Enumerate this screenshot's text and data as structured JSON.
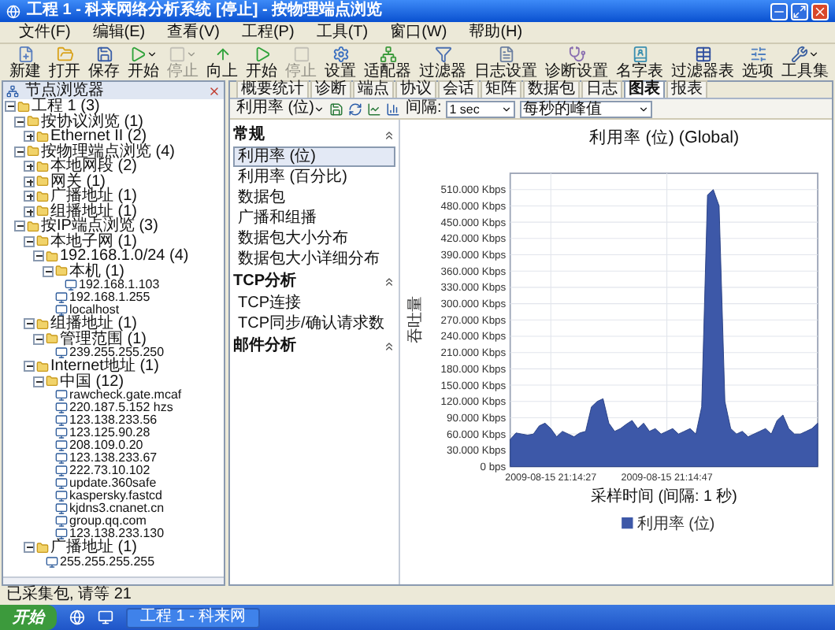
{
  "window": {
    "title": "工程 1 - 科来网络分析系统 [停止] - 按物理端点浏览"
  },
  "menu": [
    "文件(F)",
    "编辑(E)",
    "查看(V)",
    "工程(P)",
    "工具(T)",
    "窗口(W)",
    "帮助(H)"
  ],
  "toolbar": [
    {
      "label": "新建",
      "kind": "button",
      "disabled": false
    },
    {
      "label": "打开",
      "kind": "button",
      "disabled": false
    },
    {
      "label": "保存",
      "kind": "button",
      "disabled": false
    },
    {
      "label": "开始",
      "kind": "dropdown",
      "disabled": false
    },
    {
      "label": "停止",
      "kind": "dropdown",
      "disabled": true
    },
    {
      "label": "向上",
      "kind": "button",
      "disabled": false
    },
    {
      "label": "开始",
      "kind": "button",
      "disabled": false
    },
    {
      "label": "停止",
      "kind": "button",
      "disabled": true
    },
    {
      "label": "设置",
      "kind": "button",
      "disabled": false
    },
    {
      "label": "适配器",
      "kind": "button",
      "disabled": false
    },
    {
      "label": "过滤器",
      "kind": "button",
      "disabled": false
    },
    {
      "label": "日志设置",
      "kind": "button",
      "disabled": false
    },
    {
      "label": "诊断设置",
      "kind": "button",
      "disabled": false
    },
    {
      "label": "名字表",
      "kind": "button",
      "disabled": false
    },
    {
      "label": "过滤器表",
      "kind": "button",
      "disabled": false
    },
    {
      "label": "选项",
      "kind": "button",
      "disabled": false
    },
    {
      "label": "工具集",
      "kind": "dropdown",
      "disabled": false
    }
  ],
  "node_browser": {
    "title": "节点浏览器",
    "tree": [
      {
        "label": "工程 1 (3)",
        "expanded": true,
        "children": [
          {
            "label": "按协议浏览 (1)",
            "expanded": true,
            "children": [
              {
                "label": "Ethernet II (2)",
                "expanded": false
              }
            ]
          },
          {
            "label": "按物理端点浏览 (4)",
            "expanded": true,
            "children": [
              {
                "label": "本地网段 (2)",
                "expanded": false
              },
              {
                "label": "网关 (1)",
                "expanded": false
              },
              {
                "label": "广播地址 (1)",
                "expanded": false
              },
              {
                "label": "组播地址 (1)",
                "expanded": false
              }
            ]
          },
          {
            "label": "按IP端点浏览 (3)",
            "expanded": true,
            "children": [
              {
                "label": "本地子网 (1)",
                "expanded": true,
                "children": [
                  {
                    "label": "192.168.1.0/24 (4)",
                    "expanded": true,
                    "children": [
                      {
                        "label": "本机 (1)",
                        "expanded": true,
                        "children": [
                          {
                            "label": "192.168.1.103"
                          }
                        ]
                      },
                      {
                        "label": "192.168.1.255"
                      },
                      {
                        "label": "localhost"
                      }
                    ]
                  }
                ]
              },
              {
                "label": "组播地址 (1)",
                "expanded": true,
                "children": [
                  {
                    "label": "管理范围 (1)",
                    "expanded": true,
                    "children": [
                      {
                        "label": "239.255.255.250"
                      }
                    ]
                  }
                ]
              },
              {
                "label": "Internet地址 (1)",
                "expanded": true,
                "children": [
                  {
                    "label": "中国 (12)",
                    "expanded": true,
                    "children": [
                      {
                        "label": "rawcheck.gate.mcaf"
                      },
                      {
                        "label": "220.187.5.152 hzs"
                      },
                      {
                        "label": "123.138.233.56"
                      },
                      {
                        "label": "123.125.90.28"
                      },
                      {
                        "label": "208.109.0.20"
                      },
                      {
                        "label": "123.138.233.67"
                      },
                      {
                        "label": "222.73.10.102"
                      },
                      {
                        "label": "update.360safe"
                      },
                      {
                        "label": "kaspersky.fastcd"
                      },
                      {
                        "label": "kjdns3.cnanet.cn"
                      },
                      {
                        "label": "group.qq.com"
                      },
                      {
                        "label": "123.138.233.130"
                      }
                    ]
                  }
                ]
              },
              {
                "label": "广播地址 (1)",
                "expanded": true,
                "children": [
                  {
                    "label": "255.255.255.255"
                  }
                ]
              }
            ]
          }
        ]
      }
    ]
  },
  "tabs": [
    {
      "label": "概要统计",
      "selected": false
    },
    {
      "label": "诊断",
      "selected": false
    },
    {
      "label": "端点",
      "selected": false
    },
    {
      "label": "协议",
      "selected": false
    },
    {
      "label": "会话",
      "selected": false
    },
    {
      "label": "矩阵",
      "selected": false
    },
    {
      "label": "数据包",
      "selected": false
    },
    {
      "label": "日志",
      "selected": false
    },
    {
      "label": "图表",
      "selected": true
    },
    {
      "label": "报表",
      "selected": false
    }
  ],
  "chart_toolbar": {
    "metric": "利用率 (位)",
    "interval_label": "间隔:",
    "interval": "1 sec",
    "mode": "每秒的峰值"
  },
  "chart_list": [
    {
      "title": "常规",
      "items": [
        {
          "label": "利用率 (位)",
          "selected": true
        },
        {
          "label": "利用率 (百分比)",
          "selected": false
        },
        {
          "label": "数据包",
          "selected": false
        },
        {
          "label": "广播和组播",
          "selected": false
        },
        {
          "label": "数据包大小分布",
          "selected": false
        },
        {
          "label": "数据包大小详细分布",
          "selected": false
        }
      ]
    },
    {
      "title": "TCP分析",
      "items": [
        {
          "label": "TCP连接",
          "selected": false
        },
        {
          "label": "TCP同步/确认请求数",
          "selected": false
        }
      ]
    },
    {
      "title": "邮件分析"
    }
  ],
  "chart": {
    "chart_data": {
      "type": "area",
      "title": "利用率 (位) (Global)",
      "xlabel": "采样时间 (间隔: 1 秒)",
      "ylabel": "吞吐量",
      "grid": true,
      "categories": [
        null,
        null,
        null,
        null,
        null,
        null,
        null,
        "2009-08-15 21:14:27",
        null,
        null,
        null,
        null,
        null,
        null,
        null,
        null,
        null,
        null,
        null,
        null,
        null,
        null,
        null,
        null,
        null,
        null,
        null,
        "2009-08-15 21:14:47",
        null,
        null,
        null,
        null,
        null,
        null,
        null,
        null,
        null,
        null,
        null,
        null,
        null,
        null,
        null,
        null,
        null,
        null,
        null,
        null,
        null,
        null,
        null,
        null,
        null,
        null
      ],
      "series": [
        {
          "name": "利用率 (位)",
          "color": "#3d58a8",
          "values": [
            50000,
            62000,
            60000,
            58000,
            60000,
            75000,
            80000,
            70000,
            55000,
            65000,
            60000,
            55000,
            62000,
            65000,
            110000,
            120000,
            125000,
            80000,
            65000,
            70000,
            78000,
            85000,
            70000,
            80000,
            65000,
            70000,
            60000,
            65000,
            70000,
            60000,
            65000,
            70000,
            60000,
            110000,
            500000,
            510000,
            480000,
            120000,
            70000,
            60000,
            65000,
            55000,
            60000,
            65000,
            70000,
            60000,
            85000,
            95000,
            70000,
            60000,
            60000,
            65000,
            70000,
            80000
          ]
        }
      ],
      "ylim": [
        0,
        540000
      ],
      "yticks": [
        {
          "value": 0,
          "label": "0 bps"
        },
        {
          "value": 30000,
          "label": "30.000 Kbps"
        },
        {
          "value": 60000,
          "label": "60.000 Kbps"
        },
        {
          "value": 90000,
          "label": "90.000 Kbps"
        },
        {
          "value": 120000,
          "label": "120.000 Kbps"
        },
        {
          "value": 150000,
          "label": "150.000 Kbps"
        },
        {
          "value": 180000,
          "label": "180.000 Kbps"
        },
        {
          "value": 210000,
          "label": "210.000 Kbps"
        },
        {
          "value": 240000,
          "label": "240.000 Kbps"
        },
        {
          "value": 270000,
          "label": "270.000 Kbps"
        },
        {
          "value": 300000,
          "label": "300.000 Kbps"
        },
        {
          "value": 330000,
          "label": "330.000 Kbps"
        },
        {
          "value": 360000,
          "label": "360.000 Kbps"
        },
        {
          "value": 390000,
          "label": "390.000 Kbps"
        },
        {
          "value": 420000,
          "label": "420.000 Kbps"
        },
        {
          "value": 450000,
          "label": "450.000 Kbps"
        },
        {
          "value": 480000,
          "label": "480.000 Kbps"
        },
        {
          "value": 510000,
          "label": "510.000 Kbps"
        }
      ]
    }
  },
  "status_bar": "已采集包, 请等 21",
  "taskbar": {
    "start": "开始",
    "items": [
      {
        "label": "工程 1 - 科来网"
      }
    ]
  }
}
